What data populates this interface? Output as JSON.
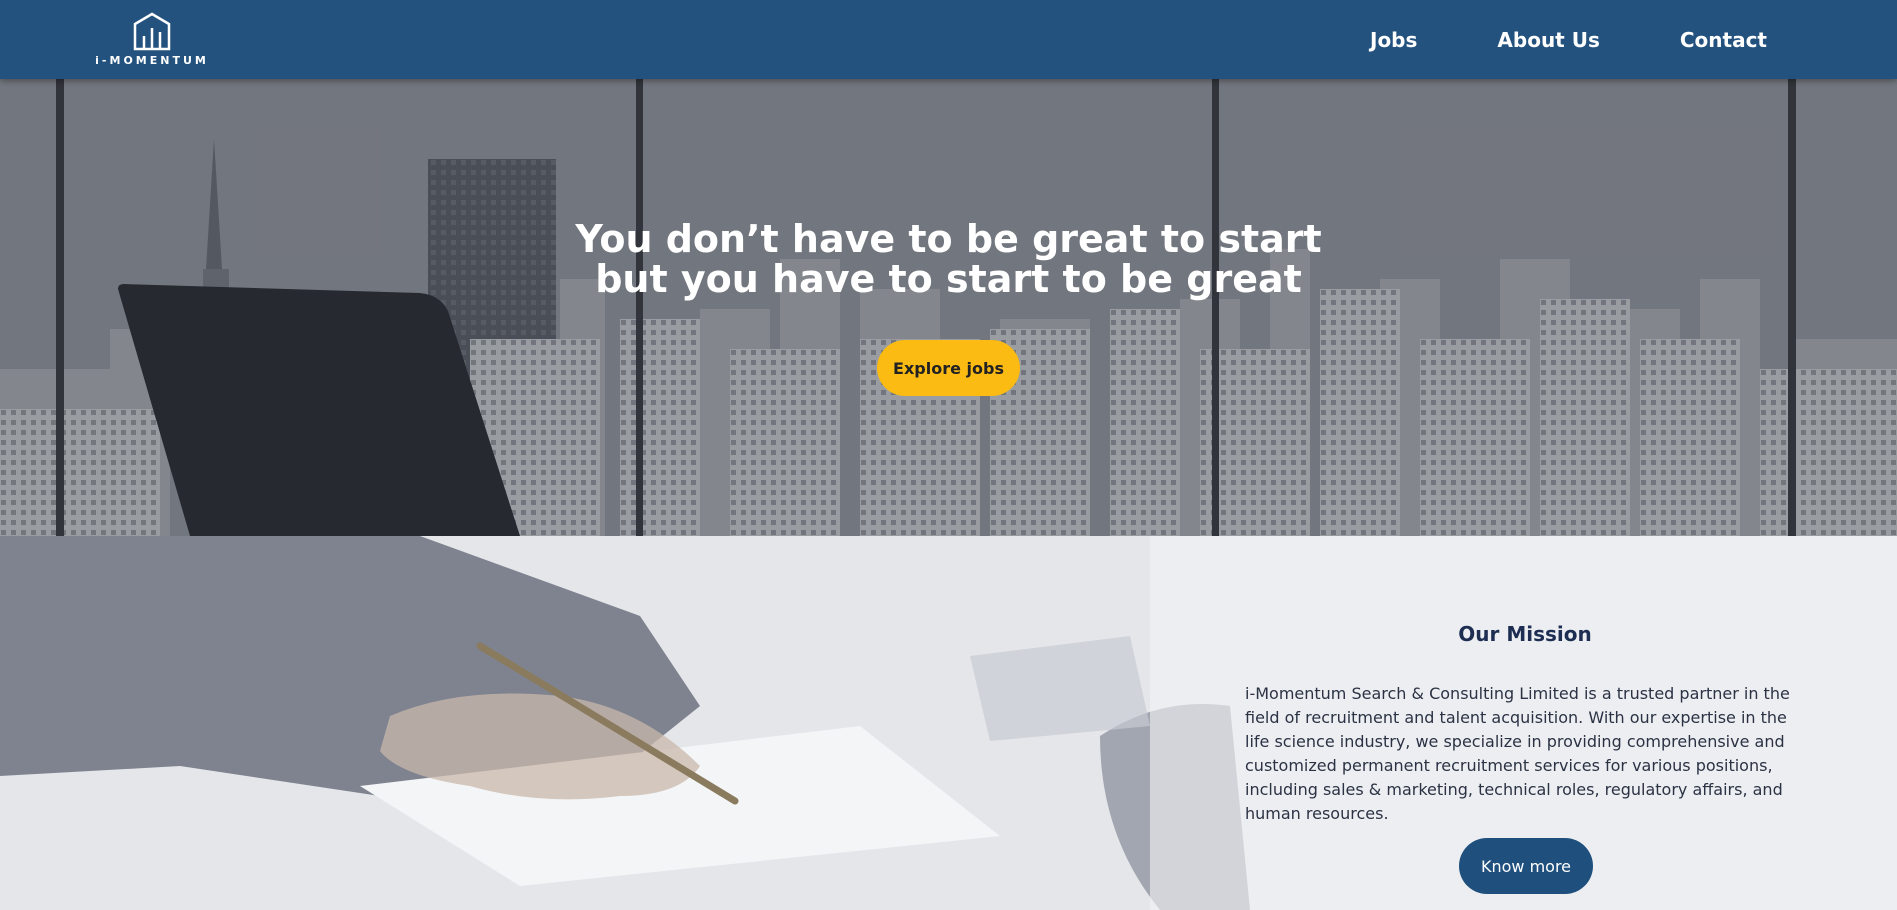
{
  "header": {
    "logo_text": "i-MOMENTUM",
    "logo_icon": "building-bars-icon",
    "nav": {
      "jobs": "Jobs",
      "about": "About Us",
      "contact": "Contact"
    },
    "bg_color": "#23527f"
  },
  "hero": {
    "title_line1": "You don’t have to be great to start",
    "title_line2": "but you have to start to be great",
    "cta_label": "Explore jobs",
    "cta_color": "#fbbb13"
  },
  "mission": {
    "title": "Our Mission",
    "text": "i-Momentum Search & Consulting Limited is a trusted partner in the field of recruitment and talent acquisition. With our expertise in the life science industry, we specialize in providing comprehensive and customized permanent recruitment services for various positions, including sales & marketing, technical roles, regulatory affairs, and human resources.",
    "cta_label": "Know more",
    "cta_color": "#1f4f7c"
  }
}
